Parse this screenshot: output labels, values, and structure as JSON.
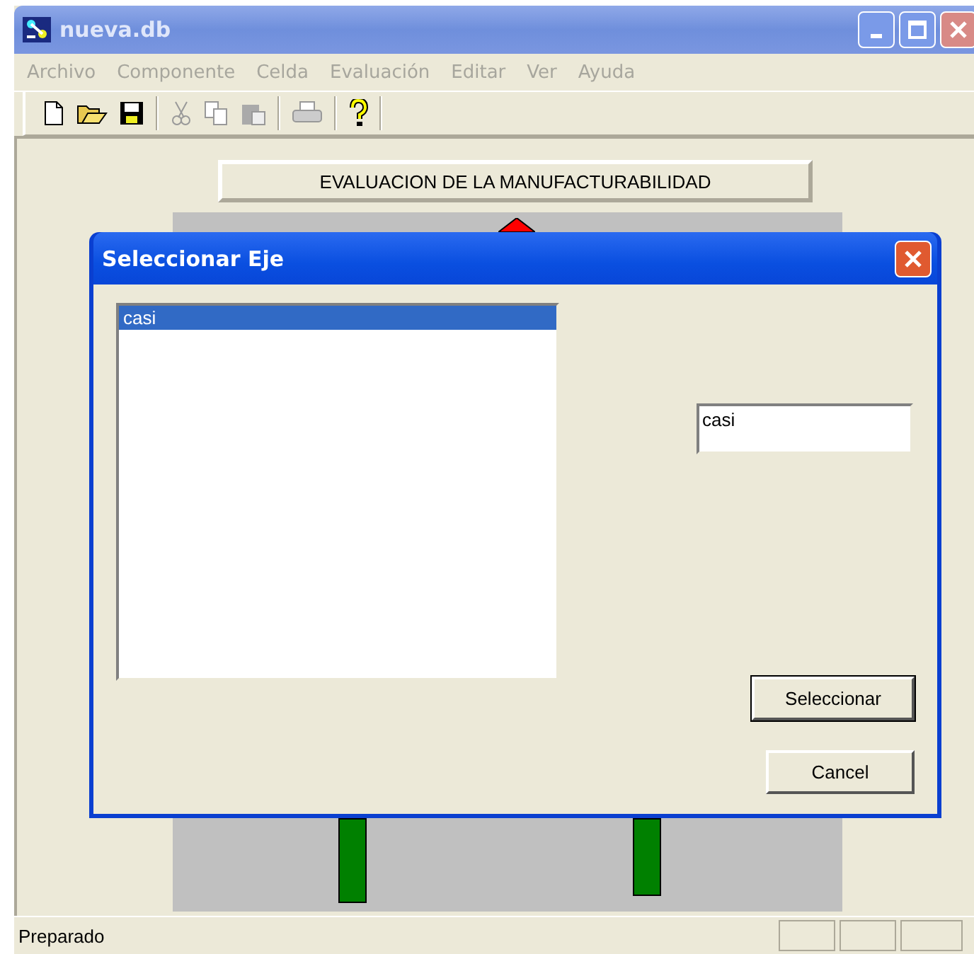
{
  "window": {
    "title": "nueva.db"
  },
  "menu": [
    {
      "label": "Archivo",
      "disabled": true
    },
    {
      "label": "Componente",
      "disabled": true
    },
    {
      "label": "Celda",
      "disabled": true
    },
    {
      "label": "Evaluación",
      "disabled": true
    },
    {
      "label": "Editar",
      "disabled": true
    },
    {
      "label": "Ver",
      "disabled": true
    },
    {
      "label": "Ayuda",
      "disabled": true
    }
  ],
  "toolbar": [
    [
      {
        "kind": "new",
        "disabled": false
      },
      {
        "kind": "open",
        "disabled": false
      },
      {
        "kind": "save",
        "disabled": false
      }
    ],
    [
      {
        "kind": "cut",
        "disabled": true
      },
      {
        "kind": "copy",
        "disabled": true
      },
      {
        "kind": "paste",
        "disabled": true
      }
    ],
    [
      {
        "kind": "print",
        "disabled": true
      }
    ],
    [
      {
        "kind": "help",
        "disabled": false
      }
    ]
  ],
  "canvas": {
    "title": "EVALUACION DE LA MANUFACTURABILIDAD"
  },
  "dialog": {
    "title": "Seleccionar Eje",
    "list": [
      {
        "label": "casi",
        "selected": true
      }
    ],
    "field": {
      "value": "casi"
    },
    "buttons": [
      "Seleccionar",
      "Cancel"
    ]
  },
  "status_bar": {
    "text": "Preparado"
  }
}
